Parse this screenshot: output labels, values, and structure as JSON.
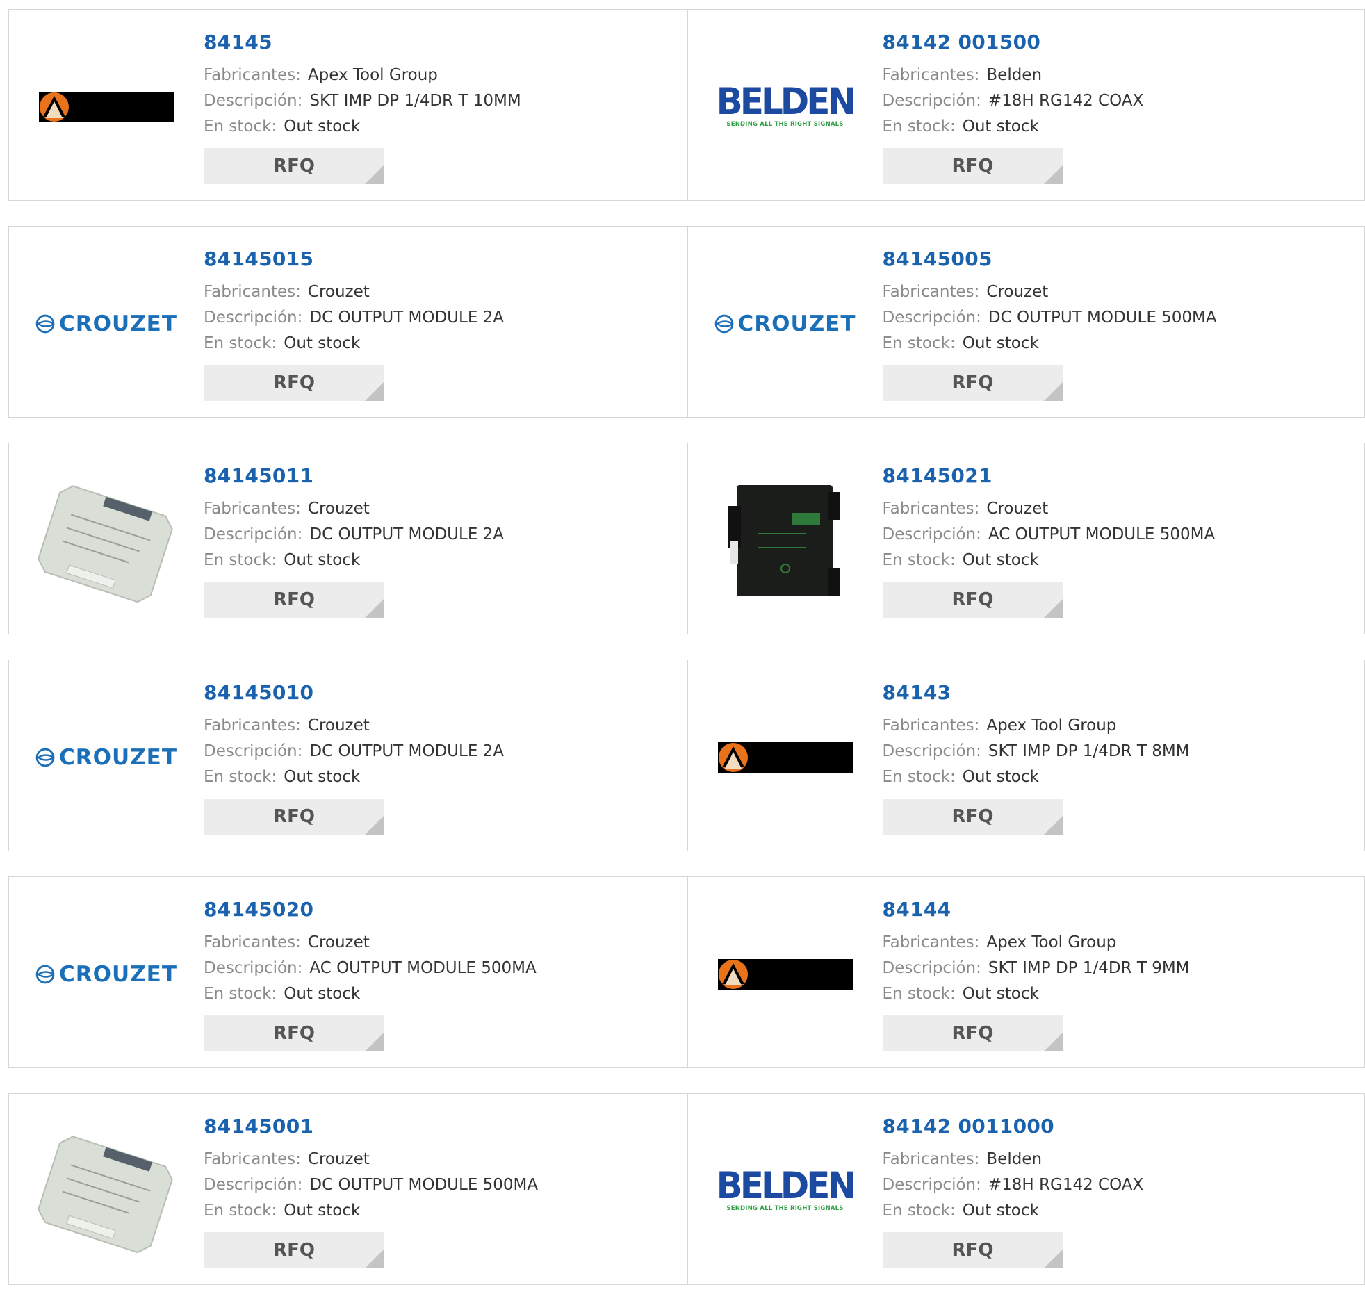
{
  "labels": {
    "fabricantes": "Fabricantes:",
    "descripcion": "Descripción:",
    "stock": "En stock:",
    "rfq": "RFQ"
  },
  "rows": [
    [
      {
        "part": "84145",
        "manufacturer": "Apex Tool Group",
        "description": "SKT IMP DP 1/4DR T 10MM",
        "stock": "Out stock",
        "image": "apex-logo"
      },
      {
        "part": "84142 001500",
        "manufacturer": "Belden",
        "description": "#18H RG142 COAX",
        "stock": "Out stock",
        "image": "belden-logo"
      }
    ],
    [
      {
        "part": "84145015",
        "manufacturer": "Crouzet",
        "description": "DC OUTPUT MODULE 2A",
        "stock": "Out stock",
        "image": "crouzet-logo"
      },
      {
        "part": "84145005",
        "manufacturer": "Crouzet",
        "description": "DC OUTPUT MODULE 500MA",
        "stock": "Out stock",
        "image": "crouzet-logo"
      }
    ],
    [
      {
        "part": "84145011",
        "manufacturer": "Crouzet",
        "description": "DC OUTPUT MODULE 2A",
        "stock": "Out stock",
        "image": "module-photo-grey"
      },
      {
        "part": "84145021",
        "manufacturer": "Crouzet",
        "description": "AC OUTPUT MODULE 500MA",
        "stock": "Out stock",
        "image": "module-photo-black"
      }
    ],
    [
      {
        "part": "84145010",
        "manufacturer": "Crouzet",
        "description": "DC OUTPUT MODULE 2A",
        "stock": "Out stock",
        "image": "crouzet-logo"
      },
      {
        "part": "84143",
        "manufacturer": "Apex Tool Group",
        "description": "SKT IMP DP 1/4DR T 8MM",
        "stock": "Out stock",
        "image": "apex-logo"
      }
    ],
    [
      {
        "part": "84145020",
        "manufacturer": "Crouzet",
        "description": "AC OUTPUT MODULE 500MA",
        "stock": "Out stock",
        "image": "crouzet-logo"
      },
      {
        "part": "84144",
        "manufacturer": "Apex Tool Group",
        "description": "SKT IMP DP 1/4DR T 9MM",
        "stock": "Out stock",
        "image": "apex-logo"
      }
    ],
    [
      {
        "part": "84145001",
        "manufacturer": "Crouzet",
        "description": "DC OUTPUT MODULE 500MA",
        "stock": "Out stock",
        "image": "module-photo-grey"
      },
      {
        "part": "84142 0011000",
        "manufacturer": "Belden",
        "description": "#18H RG142 COAX",
        "stock": "Out stock",
        "image": "belden-logo"
      }
    ]
  ],
  "logos": {
    "belden_word": "BELDEN",
    "belden_tagline": "SENDING ALL THE RIGHT SIGNALS",
    "crouzet_word": "CROUZET"
  },
  "colors": {
    "part_link": "#1a62ad",
    "label": "#8a8a8a",
    "value": "#333333",
    "rfq_bg": "#ececec",
    "belden_blue": "#1b4aa0",
    "belden_green": "#2f9e44",
    "crouzet_blue": "#1b6fb8",
    "apex_orange": "#e8731c"
  }
}
